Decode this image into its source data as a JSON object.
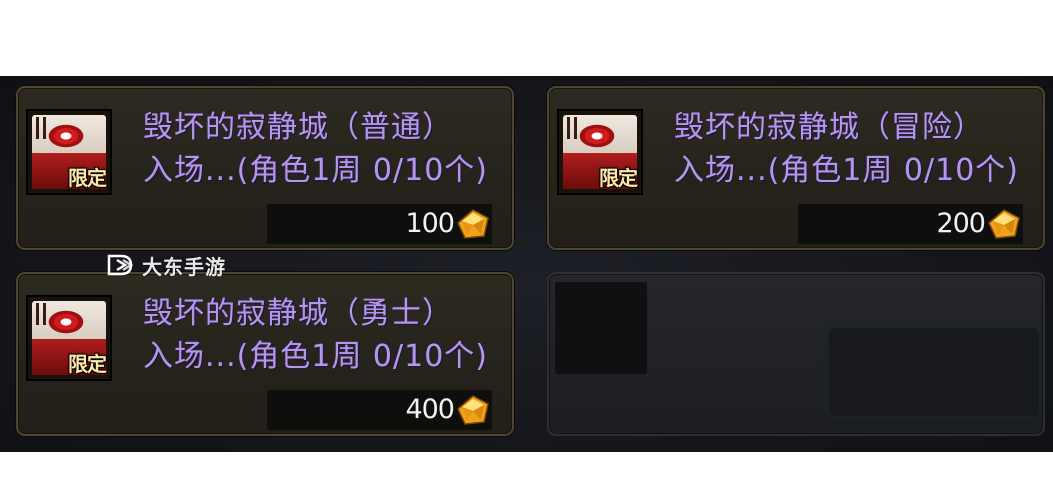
{
  "watermark": {
    "text": "大东手游"
  },
  "items": [
    {
      "title": "毁坏的寂静城（普通）",
      "limit": "入场...(角色1周 0/10个)",
      "price": "100",
      "tag": "限定",
      "currency_icon": "gold-gem-icon"
    },
    {
      "title": "毁坏的寂静城（冒险）",
      "limit": "入场...(角色1周 0/10个)",
      "price": "200",
      "tag": "限定",
      "currency_icon": "gold-gem-icon"
    },
    {
      "title": "毁坏的寂静城（勇士）",
      "limit": "入场...(角色1周 0/10个)",
      "price": "400",
      "tag": "限定",
      "currency_icon": "gold-gem-icon"
    }
  ],
  "colors": {
    "title_text": "#b596ee",
    "price_text": "#f2f2f2",
    "card_border": "#4e4630",
    "tag_text": "#ffe9a8"
  }
}
